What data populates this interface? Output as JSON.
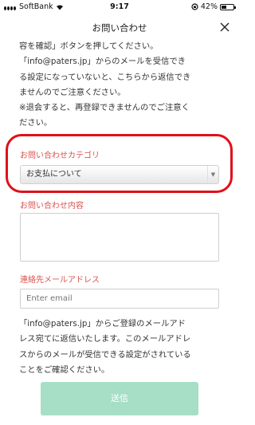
{
  "status_bar": {
    "carrier": "SoftBank",
    "time": "9:17",
    "battery": "42%",
    "battery_level": 0.42
  },
  "header": {
    "title": "お問い合わせ"
  },
  "notice": {
    "text": "容を確認」ボタンを押してください。\n「info@paters.jp」からのメールを受信でき\nる設定になっていないと、こちらから返信でき\nませんのでご注意ください。\n※退会すると、再登録できませんのでご注意く\nださい。"
  },
  "category": {
    "label": "お問い合わせカテゴリ",
    "selected": "お支払について"
  },
  "content": {
    "label": "お問い合わせ内容",
    "value": ""
  },
  "email": {
    "label": "連絡先メールアドレス",
    "placeholder": "Enter email"
  },
  "footer_note": {
    "text": "「info@paters.jp」からご登録のメールアド\nレス宛てに返信いたします。このメールアドレ\nスからのメールが受信できる設定がされている\nことをご確認ください。"
  },
  "submit": {
    "label": "送信"
  },
  "colors": {
    "accent_red": "#d9534f",
    "highlight": "#e0101a",
    "submit_bg": "#a6dec6"
  }
}
